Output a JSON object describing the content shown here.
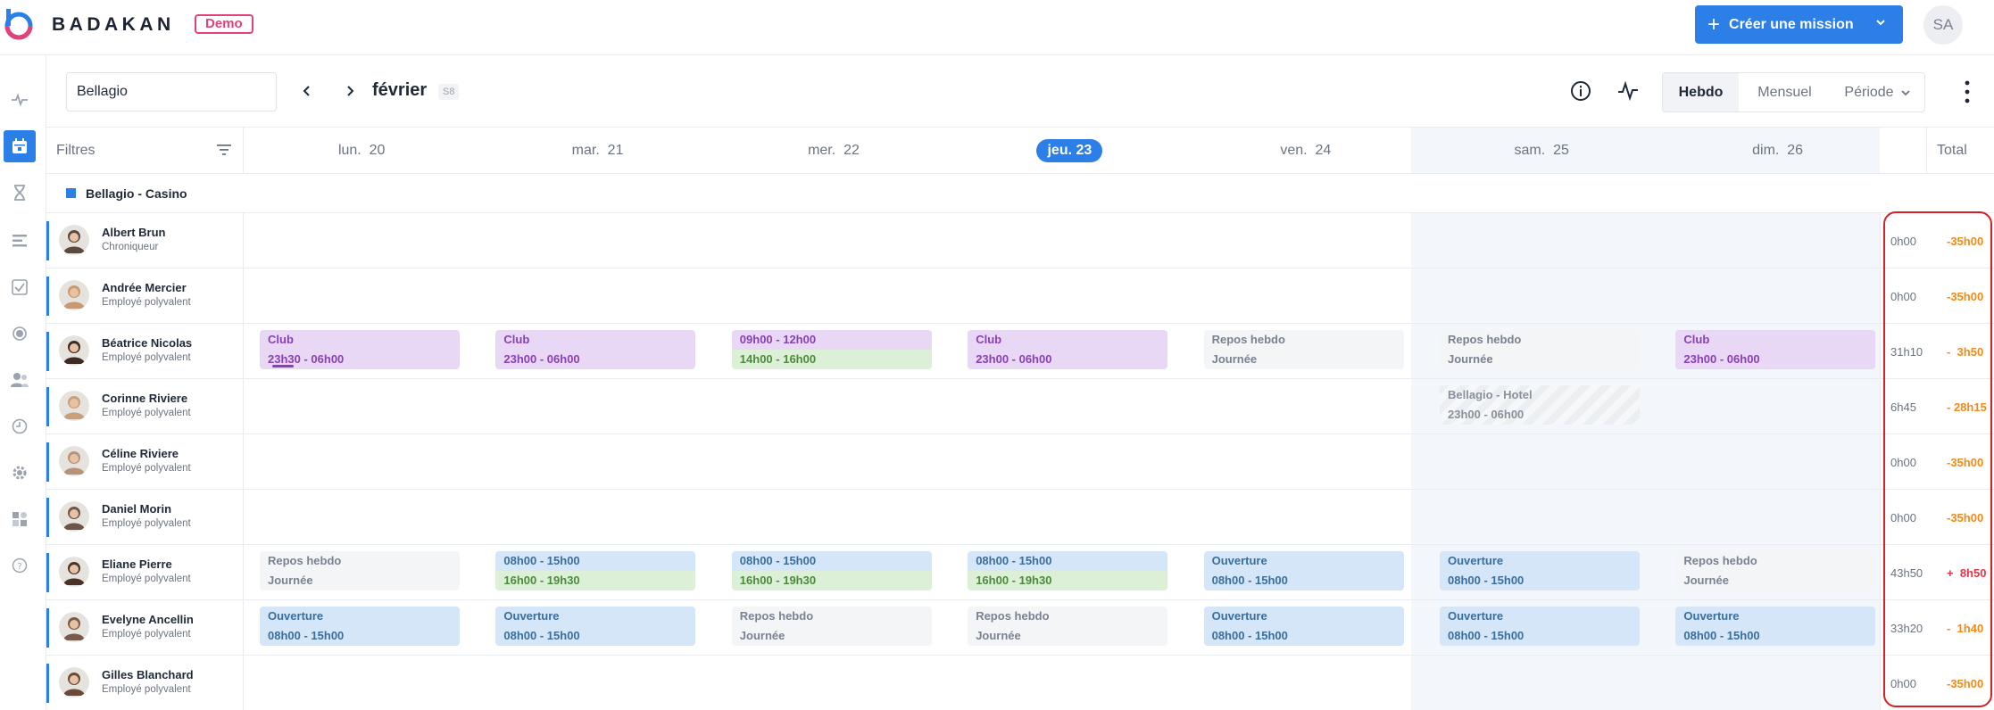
{
  "header": {
    "brand": "BADAKAN",
    "badge": "Demo",
    "create_button": "Créer une mission",
    "user_initials": "SA",
    "accent_color": "#2b7fe6"
  },
  "sidebar": {
    "icons": [
      "activity-icon",
      "calendar-icon",
      "hourglass-icon",
      "list-icon",
      "check-icon",
      "record-icon",
      "users-icon",
      "clock-icon",
      "settings-icon",
      "apps-icon",
      "help-icon"
    ],
    "active": "calendar-icon"
  },
  "toolbar": {
    "site_value": "Bellagio",
    "month": "février",
    "week": "S8",
    "views": [
      "Hebdo",
      "Mensuel",
      "Période"
    ],
    "active_view": "Hebdo"
  },
  "grid": {
    "filters_label": "Filtres",
    "days": [
      {
        "label": "lun.  20",
        "today": false
      },
      {
        "label": "mar.  21",
        "today": false
      },
      {
        "label": "mer.  22",
        "today": false
      },
      {
        "label": "jeu. 23",
        "today": true
      },
      {
        "label": "ven.  24",
        "today": false
      },
      {
        "label": "sam.  25",
        "today": false
      },
      {
        "label": "dim.  26",
        "today": false
      }
    ],
    "total_label": "Total",
    "group": "Bellagio - Casino",
    "employees": [
      {
        "name": "Albert Brun",
        "role": "Chroniqueur",
        "total": "0h00",
        "diff": "-35h00",
        "diff_type": "neg",
        "shifts": []
      },
      {
        "name": "Andrée Mercier",
        "role": "Employé polyvalent",
        "total": "0h00",
        "diff": "-35h00",
        "diff_type": "neg",
        "shifts": []
      },
      {
        "name": "Béatrice Nicolas",
        "role": "Employé polyvalent",
        "total": "31h10",
        "diff": "-  3h50",
        "diff_type": "neg",
        "shifts": [
          {
            "day": 0,
            "kind": "purple",
            "line1": "Club",
            "line2": "23h30 - 06h00",
            "progress": true
          },
          {
            "day": 1,
            "kind": "purple",
            "line1": "Club",
            "line2": "23h00 - 06h00"
          },
          {
            "day": 2,
            "kind": "split pv",
            "line1": "09h00 - 12h00",
            "line2": "14h00 - 16h00"
          },
          {
            "day": 3,
            "kind": "purple",
            "line1": "Club",
            "line2": "23h00 - 06h00"
          },
          {
            "day": 4,
            "kind": "repos",
            "line1": "Repos hebdo",
            "line2": "Journée"
          },
          {
            "day": 5,
            "kind": "repos",
            "line1": "Repos hebdo",
            "line2": "Journée"
          },
          {
            "day": 6,
            "kind": "purple",
            "line1": "Club",
            "line2": "23h00 - 06h00"
          }
        ]
      },
      {
        "name": "Corinne Riviere",
        "role": "Employé polyvalent",
        "total": "6h45",
        "diff": "- 28h15",
        "diff_type": "neg",
        "shifts": [
          {
            "day": 5,
            "kind": "hatched",
            "line1": "Bellagio - Hotel",
            "line2": "23h00 - 06h00"
          }
        ]
      },
      {
        "name": "Céline Riviere",
        "role": "Employé polyvalent",
        "total": "0h00",
        "diff": "-35h00",
        "diff_type": "neg",
        "shifts": []
      },
      {
        "name": "Daniel Morin",
        "role": "Employé polyvalent",
        "total": "0h00",
        "diff": "-35h00",
        "diff_type": "neg",
        "shifts": []
      },
      {
        "name": "Eliane Pierre",
        "role": "Employé polyvalent",
        "total": "43h50",
        "diff": "+  8h50",
        "diff_type": "pos",
        "shifts": [
          {
            "day": 0,
            "kind": "repos",
            "line1": "Repos hebdo",
            "line2": "Journée"
          },
          {
            "day": 1,
            "kind": "split",
            "line1": "08h00 - 15h00",
            "line2": "16h00 - 19h30"
          },
          {
            "day": 2,
            "kind": "split",
            "line1": "08h00 - 15h00",
            "line2": "16h00 - 19h30"
          },
          {
            "day": 3,
            "kind": "split",
            "line1": "08h00 - 15h00",
            "line2": "16h00 - 19h30"
          },
          {
            "day": 4,
            "kind": "blue",
            "line1": "Ouverture",
            "line2": "08h00 - 15h00"
          },
          {
            "day": 5,
            "kind": "blue",
            "line1": "Ouverture",
            "line2": "08h00 - 15h00"
          },
          {
            "day": 6,
            "kind": "repos",
            "line1": "Repos hebdo",
            "line2": "Journée"
          }
        ]
      },
      {
        "name": "Evelyne Ancellin",
        "role": "Employé polyvalent",
        "total": "33h20",
        "diff": "-  1h40",
        "diff_type": "neg",
        "shifts": [
          {
            "day": 0,
            "kind": "blue",
            "line1": "Ouverture",
            "line2": "08h00 - 15h00"
          },
          {
            "day": 1,
            "kind": "blue",
            "line1": "Ouverture",
            "line2": "08h00 - 15h00"
          },
          {
            "day": 2,
            "kind": "repos",
            "line1": "Repos hebdo",
            "line2": "Journée"
          },
          {
            "day": 3,
            "kind": "repos",
            "line1": "Repos hebdo",
            "line2": "Journée"
          },
          {
            "day": 4,
            "kind": "blue",
            "line1": "Ouverture",
            "line2": "08h00 - 15h00"
          },
          {
            "day": 5,
            "kind": "blue",
            "line1": "Ouverture",
            "line2": "08h00 - 15h00"
          },
          {
            "day": 6,
            "kind": "blue",
            "line1": "Ouverture",
            "line2": "08h00 - 15h00"
          }
        ]
      },
      {
        "name": "Gilles Blanchard",
        "role": "Employé polyvalent",
        "total": "0h00",
        "diff": "-35h00",
        "diff_type": "neg",
        "shifts": []
      }
    ]
  },
  "avatar_colors": [
    "#5b4a3f",
    "#c99a6e",
    "#3d2b22",
    "#c9a07a",
    "#b89278",
    "#6e5546",
    "#4a3226",
    "#7a5a48",
    "#6b4a38"
  ]
}
